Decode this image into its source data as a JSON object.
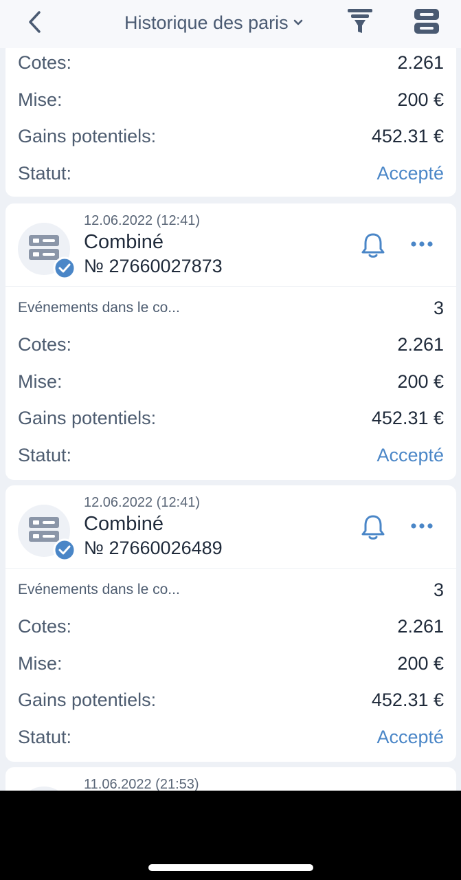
{
  "header": {
    "title": "Historique des paris",
    "back_icon": "chevron-left-icon",
    "title_dropdown_icon": "chevron-down-icon",
    "filter_icon": "filter-icon",
    "layout_icon": "layout-toggle-icon"
  },
  "colors": {
    "accent": "#4a86c7",
    "icon_gray": "#4a5a72",
    "status_accepted": "#4a86c7"
  },
  "top_card": {
    "rows": [
      {
        "label": "Cotes:",
        "value": "2.261"
      },
      {
        "label": "Mise:",
        "value": "200 €"
      },
      {
        "label": "Gains potentiels:",
        "value": "452.31 €"
      },
      {
        "label": "Statut:",
        "value": "Accepté"
      }
    ]
  },
  "bets": [
    {
      "date": "12.06.2022 (12:41)",
      "type": "Combiné",
      "number": "№ 27660027873",
      "events_label": "Evénements dans le co...",
      "events_count": "3",
      "odds_label": "Cotes:",
      "odds": "2.261",
      "stake_label": "Mise:",
      "stake": "200 €",
      "gains_label": "Gains potentiels:",
      "gains": "452.31 €",
      "status_label": "Statut:",
      "status": "Accepté"
    },
    {
      "date": "12.06.2022 (12:41)",
      "type": "Combiné",
      "number": "№ 27660026489",
      "events_label": "Evénements dans le co...",
      "events_count": "3",
      "odds_label": "Cotes:",
      "odds": "2.261",
      "stake_label": "Mise:",
      "stake": "200 €",
      "gains_label": "Gains potentiels:",
      "gains": "452.31 €",
      "status_label": "Statut:",
      "status": "Accepté"
    },
    {
      "date": "11.06.2022 (21:53)"
    }
  ]
}
